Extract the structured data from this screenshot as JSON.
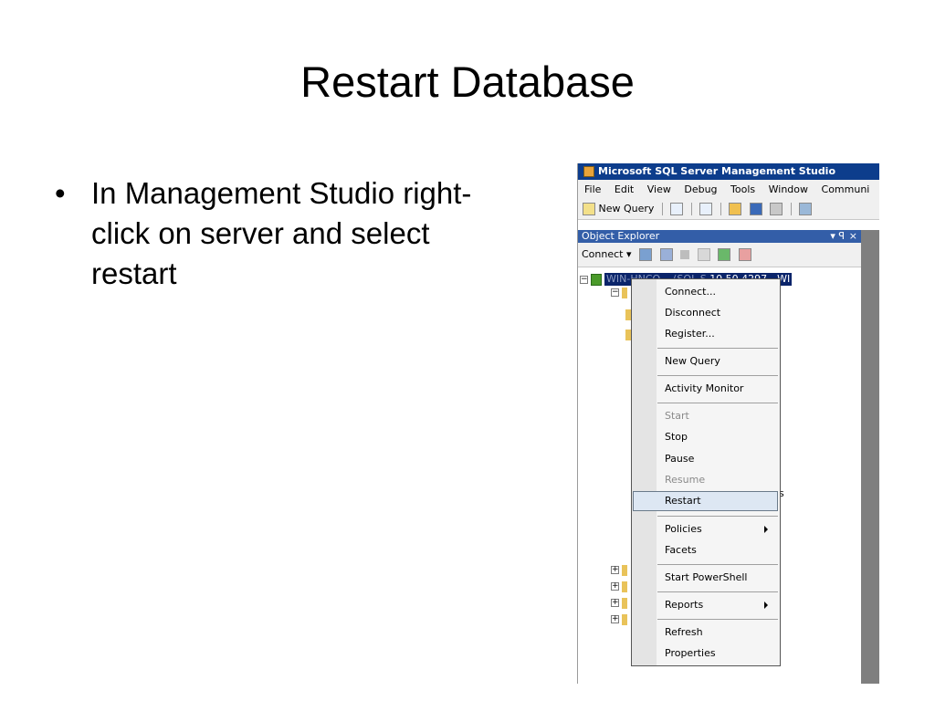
{
  "slide": {
    "title": "Restart Database",
    "bullets": [
      "In Management Studio right-click on server and select restart"
    ]
  },
  "ssms": {
    "window_title": "Microsoft SQL Server Management Studio",
    "menu": [
      "File",
      "Edit",
      "View",
      "Debug",
      "Tools",
      "Window",
      "Communi"
    ],
    "toolbar": {
      "new_query": "New Query"
    },
    "object_explorer": {
      "title": "Object Explorer",
      "pin": "▾ ꟼ",
      "close": "×",
      "connect": "Connect ▾",
      "server_visible_text": "10.50.4297 - WI"
    },
    "partial_text": "s"
  },
  "context_menu": {
    "items": {
      "connect": "Connect...",
      "disconnect": "Disconnect",
      "register": "Register...",
      "new_query": "New Query",
      "activity_monitor": "Activity Monitor",
      "start": "Start",
      "stop": "Stop",
      "pause": "Pause",
      "resume": "Resume",
      "restart": "Restart",
      "policies": "Policies",
      "facets": "Facets",
      "start_powershell": "Start PowerShell",
      "reports": "Reports",
      "refresh": "Refresh",
      "properties": "Properties"
    },
    "highlighted_item": "Restart",
    "disabled_items": [
      "Start",
      "Resume"
    ]
  },
  "colors": {
    "titlebar": "#0d3d8c",
    "object_explorer_header": "#335ea8",
    "selection": "#0a246a",
    "highlight": "#dde7f3"
  }
}
